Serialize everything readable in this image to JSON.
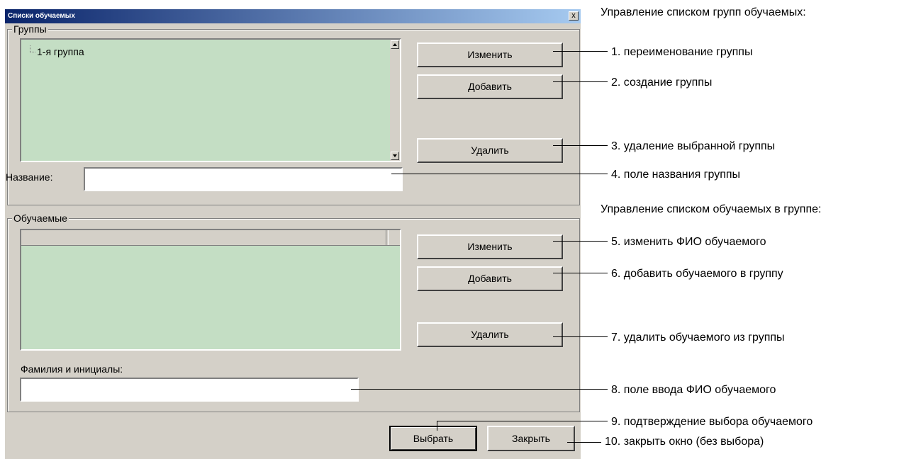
{
  "window": {
    "title": "Списки обучаемых",
    "close_glyph": "x"
  },
  "groups": {
    "legend": "Группы",
    "items": [
      "1-я группа"
    ],
    "edit_button": "Изменить",
    "add_button": "Добавить",
    "delete_button": "Удалить",
    "name_label": "Название:",
    "name_value": ""
  },
  "trainees": {
    "legend": "Обучаемые",
    "edit_button": "Изменить",
    "add_button": "Добавить",
    "delete_button": "Удалить",
    "fio_label": "Фамилия и инициалы:",
    "fio_value": ""
  },
  "footer": {
    "select_button": "Выбрать",
    "close_button": "Закрыть"
  },
  "annotations": {
    "groups_header": "Управление списком групп обучаемых:",
    "trainees_header": "Управление списком обучаемых в группе:",
    "items": [
      "1. переименование группы",
      "2. создание группы",
      "3. удаление выбранной группы",
      "4. поле названия группы",
      "5. изменить ФИО обучаемого",
      "6. добавить обучаемого в группу",
      "7. удалить обучаемого из группы",
      "8. поле ввода ФИО обучаемого",
      "9. подтверждение выбора обучаемого",
      "10. закрыть окно (без выбора)"
    ]
  },
  "colors": {
    "list_bg": "#c4dec4",
    "window_bg": "#d4d0c8",
    "titlebar": "#0a246a"
  }
}
